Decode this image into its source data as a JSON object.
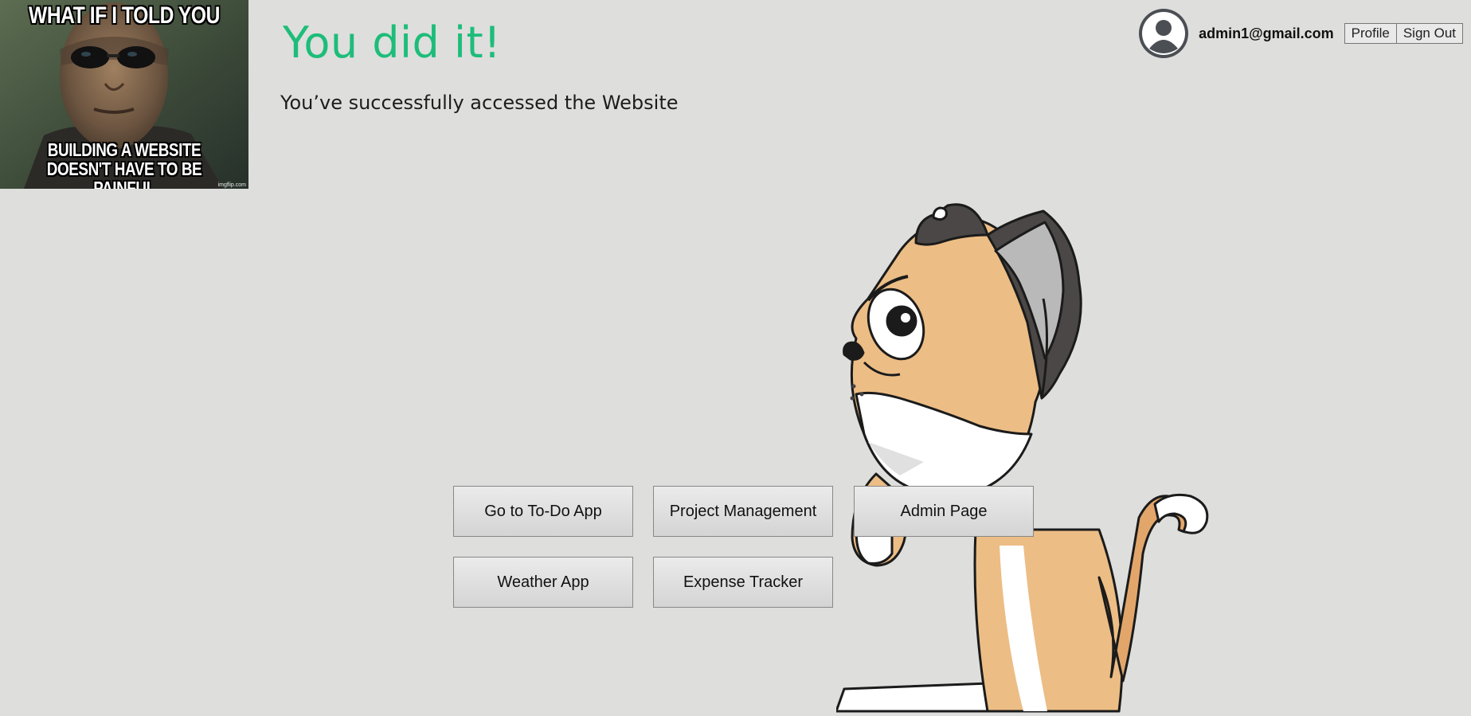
{
  "meme": {
    "top_text": "WHAT IF I TOLD YOU",
    "bottom_text": "BUILDING A WEBSITE DOESN'T HAVE TO BE PAINFUL",
    "credit": "imgflip.com"
  },
  "main": {
    "title": "You did it!",
    "subtitle": "You’ve successfully accessed the Website"
  },
  "user": {
    "avatar_icon": "user-avatar-icon",
    "email": "admin1@gmail.com",
    "profile_label": "Profile",
    "signout_label": "Sign Out"
  },
  "apps": {
    "todo": "Go to To-Do App",
    "project": "Project Management",
    "admin": "Admin Page",
    "weather": "Weather App",
    "expense": "Expense Tracker"
  },
  "colors": {
    "background": "#dededd",
    "title_green": "#1dbd79",
    "avatar_gray": "#4b4f53"
  },
  "illustration": {
    "icon": "cartoon-cat-illustration"
  }
}
